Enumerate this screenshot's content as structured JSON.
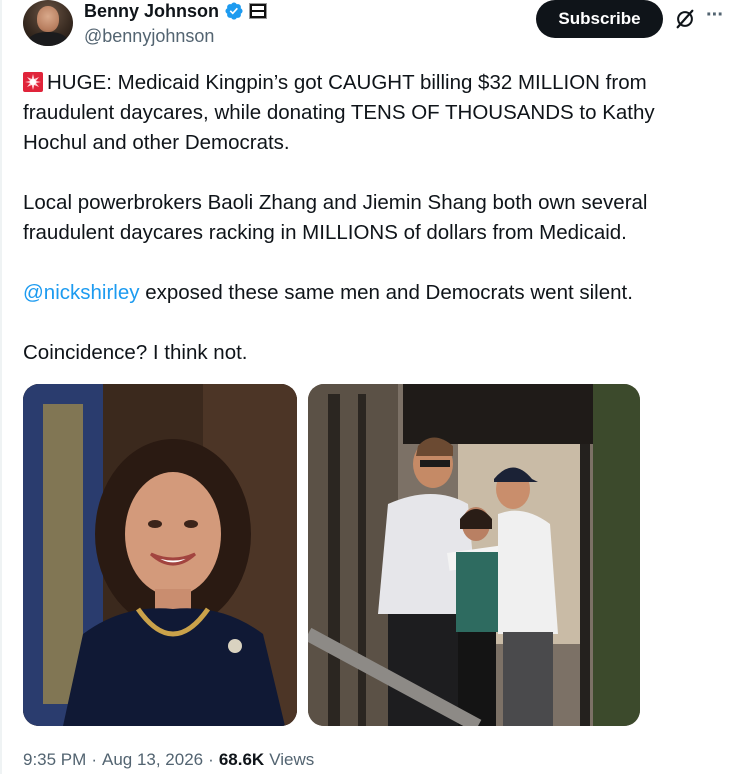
{
  "author": {
    "name": "Benny Johnson",
    "handle": "@bennyjohnson",
    "verified": true,
    "avatar_icon": "profile-photo"
  },
  "header": {
    "subscribe_label": "Subscribe",
    "grok_icon": "grok-icon",
    "more_label": "···"
  },
  "tweet": {
    "lead_icon": "rotating-light-emoji",
    "paragraph_1": "HUGE: Medicaid Kingpin’s got CAUGHT billing $32 MILLION from fraudulent daycares, while donating TENS OF THOUSANDS to Kathy Hochul and other Democrats.",
    "paragraph_2": "Local powerbrokers Baoli Zhang and Jiemin Shang both own several fraudulent daycares racking in MILLIONS of dollars from Medicaid.",
    "mention": "@nickshirley",
    "paragraph_3_rest": " exposed these same men and Democrats went silent.",
    "paragraph_4": "Coincidence? I think not."
  },
  "media": [
    {
      "kind": "photo",
      "subject": "portrait"
    },
    {
      "kind": "photo",
      "subject": "street-scene"
    }
  ],
  "meta": {
    "time": "9:35 PM",
    "separator": "·",
    "date": "Aug 13, 2026",
    "views_count": "68.6K",
    "views_label": "Views"
  },
  "colors": {
    "text": "#0f1419",
    "secondary": "#536471",
    "link": "#1d9bf0",
    "verified": "#1d9bf0",
    "button_bg": "#0f1419"
  }
}
